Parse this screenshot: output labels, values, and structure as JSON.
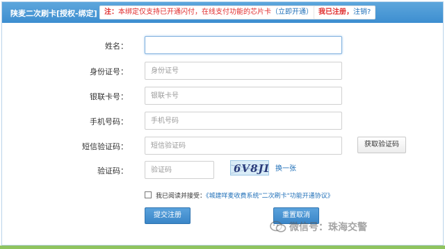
{
  "header": {
    "title": "陕麦二次刷卡[授权-绑定]",
    "notice_prefix": "注：",
    "notice_body": "本绑定仅支持已开通闪付，在线支付功能的芯片卡",
    "notice_link": "（立即开通）",
    "registered_text": "我已注册，",
    "logout_link": "注销?"
  },
  "form": {
    "name_label": "姓名：",
    "name_value": "",
    "id_label": "身份证号：",
    "id_placeholder": "身份证号",
    "card_label": "银联卡号：",
    "card_placeholder": "银联卡号",
    "phone_label": "手机号码：",
    "phone_placeholder": "手机号码",
    "sms_label": "短信验证码：",
    "sms_placeholder": "短信验证码",
    "sms_button": "获取验证码",
    "captcha_label": "验证码：",
    "captcha_placeholder": "验证码",
    "captcha_text": "6V8JL",
    "refresh_link": "换一张",
    "agree_prefix": "我已阅读并接受：",
    "agree_link": "《城建咩麦收费系统\"二次刷卡\"功能开通协议》",
    "submit_button": "提交注册",
    "reset_button": "重置取消"
  },
  "watermark": {
    "text": "微信号：珠海交警"
  },
  "colors": {
    "header_bg": "#4a98d6",
    "button_bg": "#3f8bcc",
    "notice_red": "#e02b2b",
    "link_blue": "#1f6fb8",
    "bottom_bar": "#8fc45f"
  }
}
